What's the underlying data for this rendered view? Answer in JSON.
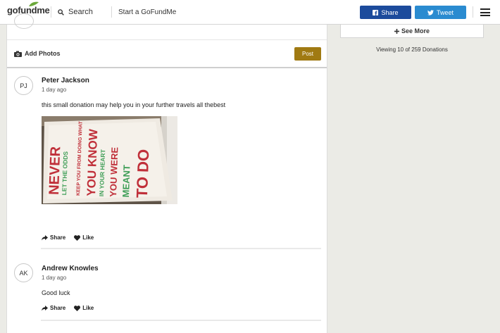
{
  "header": {
    "logo_text": "gofundme",
    "search_label": "Search",
    "start_label": "Start a GoFundMe",
    "share_label": "Share",
    "tweet_label": "Tweet",
    "share_color": "#1c4b9c",
    "tweet_color": "#2a8bd0"
  },
  "composer": {
    "add_photos_label": "Add Photos",
    "post_label": "Post",
    "post_color": "#a07a12"
  },
  "comments": [
    {
      "initials": "PJ",
      "name": "Peter Jackson",
      "time": "1 day ago",
      "text": "this small donation may help you in your further travels all thebest",
      "share_label": "Share",
      "like_label": "Like"
    },
    {
      "initials": "AK",
      "name": "Andrew Knowles",
      "time": "1 day ago",
      "text": "Good luck",
      "share_label": "Share",
      "like_label": "Like"
    }
  ],
  "poster": {
    "col1_a": "NEVER",
    "col1_b": "LET THE ODDS",
    "col2": "KEEP YOU FROM DOING WHAT",
    "col3_a": "YOU KNOW",
    "col3_b": "IN YOUR HEART",
    "col4_a": "YOU WERE",
    "col4_b": "MEANT",
    "col5": "TO DO"
  },
  "sidebar": {
    "see_more_label": "See More",
    "viewing_text": "Viewing 10 of 259 Donations"
  },
  "icons": [
    "leaf-icon",
    "search-icon",
    "facebook-icon",
    "twitter-icon",
    "menu-icon",
    "camera-icon",
    "share-arrow-icon",
    "heart-icon",
    "plus-icon"
  ]
}
